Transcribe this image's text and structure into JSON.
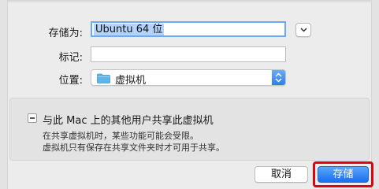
{
  "form": {
    "save_as_label": "存储为:",
    "save_as_value": "Ubuntu 64 位",
    "tags_label": "标记:",
    "tags_value": "",
    "where_label": "位置:",
    "where_value": "虚拟机"
  },
  "options": {
    "share_label": "与此 Mac 上的其他用户共享此虚拟机",
    "share_checked": false,
    "note_line1": "在共享虚拟机时，某些功能可能会受限。",
    "note_line2": "虚拟机只有保存在共享文件夹时才可用于共享。"
  },
  "buttons": {
    "cancel": "取消",
    "save": "存储"
  },
  "icons": {
    "expand": "chevron-down-icon",
    "folder": "folder-icon",
    "popup": "up-down-arrows-icon"
  },
  "colors": {
    "accent": "#2f7df0",
    "highlight": "#e3000f",
    "folder": "#5db5ee"
  }
}
